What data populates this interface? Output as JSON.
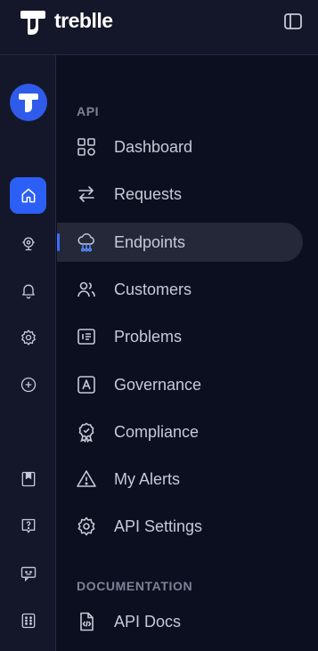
{
  "brand": {
    "name": "treblle"
  },
  "nav": {
    "sections": [
      {
        "label": "API"
      },
      {
        "label": "DOCUMENTATION"
      }
    ],
    "items": [
      {
        "label": "Dashboard",
        "icon": "grid-icon"
      },
      {
        "label": "Requests",
        "icon": "arrows-left-right-icon"
      },
      {
        "label": "Endpoints",
        "icon": "cloud-network-icon",
        "active": true
      },
      {
        "label": "Customers",
        "icon": "users-icon"
      },
      {
        "label": "Problems",
        "icon": "list-box-icon"
      },
      {
        "label": "Governance",
        "icon": "letter-a-box-icon"
      },
      {
        "label": "Compliance",
        "icon": "award-badge-icon"
      },
      {
        "label": "My Alerts",
        "icon": "warning-triangle-icon"
      },
      {
        "label": "API Settings",
        "icon": "gear-icon"
      },
      {
        "label": "API Docs",
        "icon": "code-document-icon"
      }
    ]
  },
  "rail": {
    "items": [
      {
        "icon": "home-icon",
        "active": true
      },
      {
        "icon": "tools-network-icon"
      },
      {
        "icon": "bell-icon"
      },
      {
        "icon": "gear-icon"
      },
      {
        "icon": "plus-circle-icon"
      },
      {
        "icon": "bookmark-icon"
      },
      {
        "icon": "help-icon"
      },
      {
        "icon": "chat-bot-icon"
      },
      {
        "icon": "apps-icon"
      }
    ]
  },
  "colors": {
    "accent": "#2c5ff6",
    "background": "#0c0f1f",
    "sidebar": "#141729",
    "active_row": "#242838"
  }
}
